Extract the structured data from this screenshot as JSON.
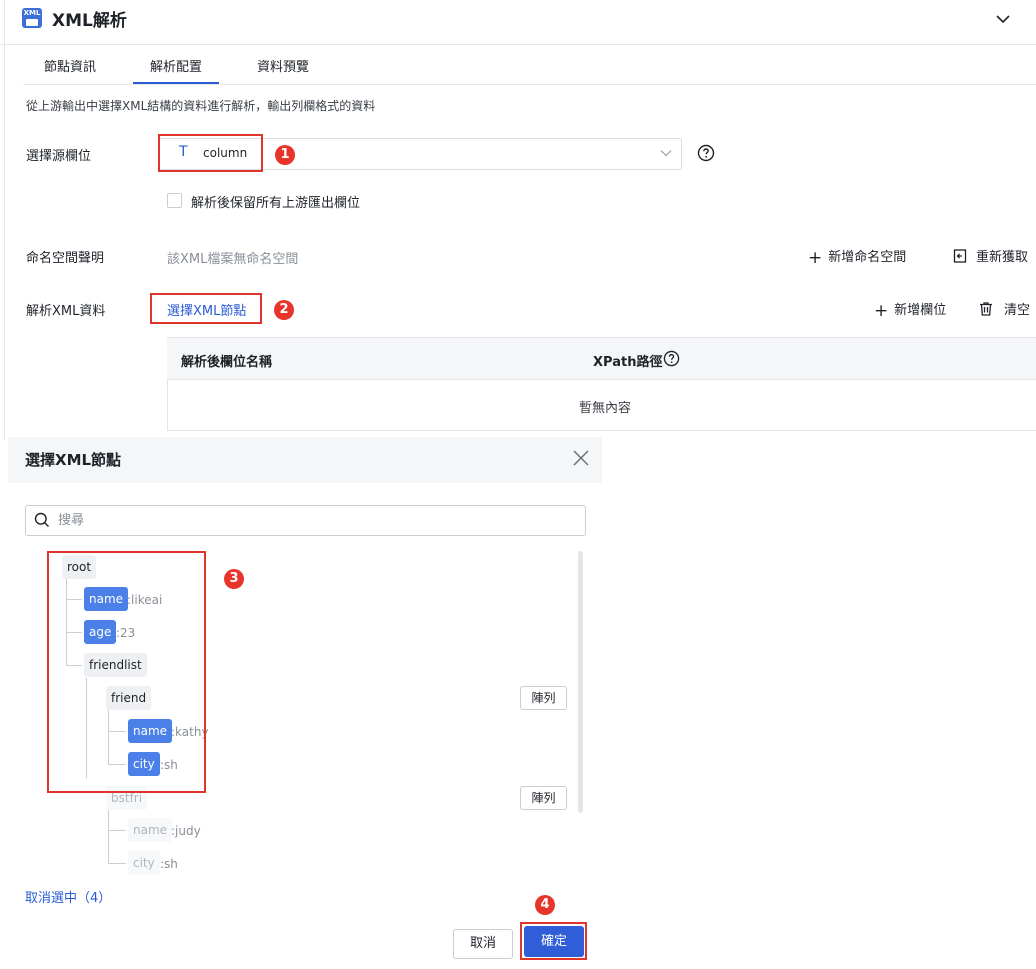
{
  "header": {
    "icon_text": "XML",
    "title": "XML解析"
  },
  "tabs": [
    {
      "label": "節點資訊"
    },
    {
      "label": "解析配置",
      "active": true
    },
    {
      "label": "資料預覽"
    }
  ],
  "description": "從上游輸出中選擇XML結構的資料進行解析，輸出列欄格式的資料",
  "source_field": {
    "label": "選擇源欄位",
    "type_icon": "T",
    "value": "column",
    "keep_upstream_label": "解析後保留所有上游匯出欄位",
    "keep_upstream_checked": false
  },
  "namespace": {
    "label": "命名空間聲明",
    "value": "該XML檔案無命名空間",
    "add_label": "新增命名空間",
    "refresh_label": "重新獲取"
  },
  "parse": {
    "label": "解析XML資料",
    "select_link": "選擇XML節點",
    "add_field_label": "新增欄位",
    "clear_label": "清空",
    "table": {
      "columns": [
        "解析後欄位名稱",
        "XPath路徑"
      ],
      "empty": "暫無內容"
    }
  },
  "annotations": [
    "1",
    "2",
    "3",
    "4"
  ],
  "dialog": {
    "title": "選擇XML節點",
    "search_placeholder": "搜尋",
    "tree": [
      {
        "tag": "root",
        "value": "",
        "selected": false,
        "dim": false
      },
      {
        "tag": "name",
        "value": ":likeai",
        "selected": true,
        "dim": false
      },
      {
        "tag": "age",
        "value": ":23",
        "selected": true,
        "dim": false
      },
      {
        "tag": "friendlist",
        "value": "",
        "selected": false,
        "dim": false
      },
      {
        "tag": "friend",
        "value": "",
        "selected": false,
        "dim": false,
        "array_label": "陣列"
      },
      {
        "tag": "name",
        "value": ":kathy",
        "selected": true,
        "dim": false
      },
      {
        "tag": "city",
        "value": ":sh",
        "selected": true,
        "dim": false
      },
      {
        "tag": "bstfri",
        "value": "",
        "selected": false,
        "dim": true,
        "array_label": "陣列"
      },
      {
        "tag": "name",
        "value": ":judy",
        "selected": false,
        "dim": true
      },
      {
        "tag": "city",
        "value": ":sh",
        "selected": false,
        "dim": true
      }
    ],
    "deselect_label": "取消選中（4）",
    "cancel_label": "取消",
    "confirm_label": "確定"
  },
  "colors": {
    "primary": "#2f5ed8",
    "selected_node": "#4a80e8",
    "annotation_red": "#e0352b"
  }
}
